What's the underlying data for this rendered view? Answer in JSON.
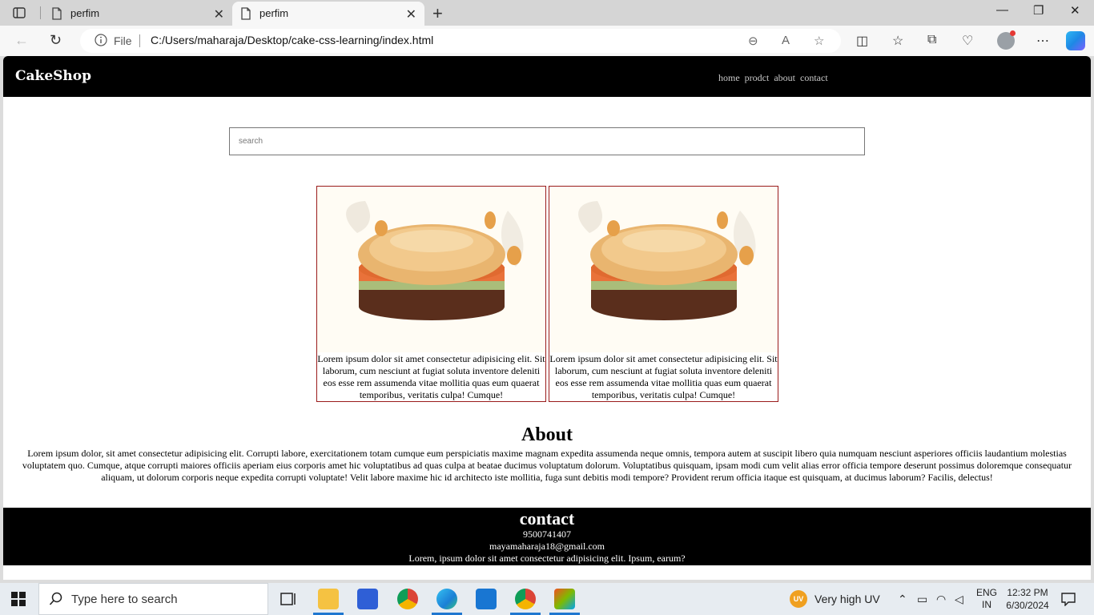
{
  "browser": {
    "tabs": [
      {
        "title": "perfim",
        "active": false
      },
      {
        "title": "perfim",
        "active": true
      }
    ],
    "address": {
      "scheme_label": "File",
      "url": "C:/Users/maharaja/Desktop/cake-css-learning/index.html"
    }
  },
  "site": {
    "brand": "CakeShop",
    "nav": [
      "home",
      "prodct",
      "about",
      "contact"
    ],
    "search_placeholder": "search",
    "cards": [
      {
        "text": "Lorem ipsum dolor sit amet consectetur adipisicing elit. Sit laborum, cum nesciunt at fugiat soluta inventore deleniti eos esse rem assumenda vitae mollitia quas eum quaerat temporibus, veritatis culpa! Cumque!"
      },
      {
        "text": "Lorem ipsum dolor sit amet consectetur adipisicing elit. Sit laborum, cum nesciunt at fugiat soluta inventore deleniti eos esse rem assumenda vitae mollitia quas eum quaerat temporibus, veritatis culpa! Cumque!"
      }
    ],
    "about": {
      "heading": "About",
      "text": "Lorem ipsum dolor, sit amet consectetur adipisicing elit. Corrupti labore, exercitationem totam cumque eum perspiciatis maxime magnam expedita assumenda neque omnis, tempora autem at suscipit libero quia numquam nesciunt asperiores officiis laudantium molestias voluptatem quo. Cumque, atque corrupti maiores officiis aperiam eius corporis amet hic voluptatibus ad quas culpa at beatae ducimus voluptatum dolorum. Voluptatibus quisquam, ipsam modi cum velit alias error officia tempore deserunt possimus doloremque consequatur aliquam, ut dolorum corporis neque expedita corrupti voluptate! Velit labore maxime hic id architecto iste mollitia, fuga sunt debitis modi tempore? Provident rerum officia itaque est quisquam, at ducimus laborum? Facilis, delectus!"
    },
    "contact": {
      "heading": "contact",
      "phone": "9500741407",
      "email": "mayamaharaja18@gmail.com",
      "text": "Lorem, ipsum dolor sit amet consectetur adipisicing elit. Ipsum, earum?"
    }
  },
  "taskbar": {
    "search_placeholder": "Type here to search",
    "weather": {
      "badge": "UV",
      "text": "Very high UV"
    },
    "language": {
      "line1": "ENG",
      "line2": "IN"
    },
    "clock": {
      "time": "12:32 PM",
      "date": "6/30/2024"
    }
  },
  "colors": {
    "card_border": "#9a1b1b",
    "header_bg": "#000000",
    "taskbar_accent": "#1f77d0"
  }
}
